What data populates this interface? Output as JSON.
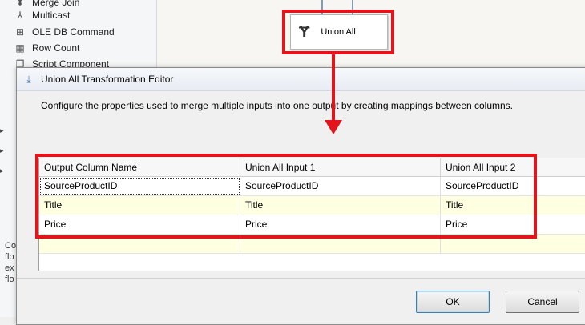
{
  "toolbox": {
    "items": [
      {
        "icon": "merge-join-icon",
        "glyph": "⬍",
        "label": "Merge Join"
      },
      {
        "icon": "multicast-icon",
        "glyph": "⅄",
        "label": "Multicast"
      },
      {
        "icon": "ole-db-command-icon",
        "glyph": "⊞",
        "label": "OLE DB Command"
      },
      {
        "icon": "row-count-icon",
        "glyph": "▦",
        "label": "Row Count"
      },
      {
        "icon": "script-component-icon",
        "glyph": "❐",
        "label": "Script Component"
      }
    ],
    "side_text": [
      "Co",
      "flo",
      "ex",
      "flo"
    ]
  },
  "designer": {
    "component_label": "Union All",
    "component_icon": "union-all-icon"
  },
  "dialog": {
    "title": "Union All Transformation Editor",
    "description": "Configure the properties used to merge multiple inputs into one output by creating mappings between columns.",
    "grid": {
      "headers": [
        "Output Column Name",
        "Union All Input 1",
        "Union All Input 2"
      ],
      "rows": [
        [
          "SourceProductID",
          "SourceProductID",
          "SourceProductID"
        ],
        [
          "Title",
          "Title",
          "Title"
        ],
        [
          "Price",
          "Price",
          "Price"
        ],
        [
          "",
          "",
          ""
        ]
      ]
    },
    "ok_label": "OK",
    "cancel_label": "Cancel"
  },
  "colors": {
    "highlight": "#e3151c",
    "alt_row": "#ffffe1"
  }
}
